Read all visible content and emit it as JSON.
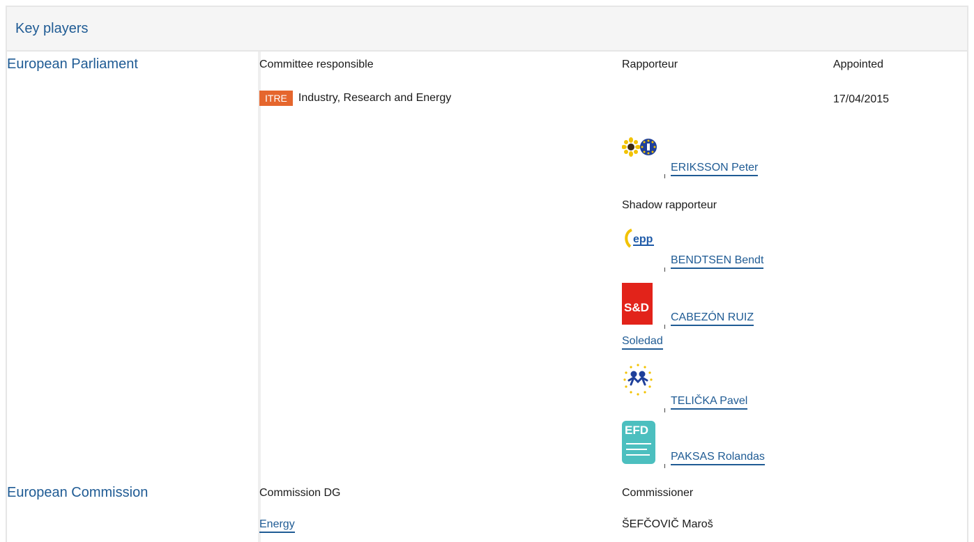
{
  "header": {
    "title": "Key players"
  },
  "parliament": {
    "name": "European Parliament",
    "col_committee": "Committee responsible",
    "col_rapporteur": "Rapporteur",
    "col_appointed": "Appointed",
    "committee_badge": "ITRE",
    "committee_name": "Industry, Research and Energy",
    "appointed_date": "17/04/2015",
    "rapporteur": {
      "name": "ERIKSSON Peter",
      "logo_icon": "greens-efa-logo-icon"
    },
    "shadow_label": "Shadow rapporteur",
    "shadows": [
      {
        "name": "BENDTSEN Bendt",
        "logo_icon": "epp-logo-icon"
      },
      {
        "name": "CABEZÓN RUIZ",
        "name_line2": "Soledad",
        "logo_icon": "sd-logo-icon"
      },
      {
        "name": "TELIČKA Pavel",
        "logo_icon": "alde-logo-icon"
      },
      {
        "name": "PAKSAS Rolandas",
        "logo_icon": "efdd-logo-icon"
      }
    ],
    "logos": {
      "epp_text": "epp",
      "sd_text": "S&D",
      "efdd_text": "EFD"
    }
  },
  "commission": {
    "name": "European Commission",
    "col_dg": "Commission DG",
    "col_commissioner": "Commissioner",
    "dg_value": "Energy",
    "commissioner_value": "ŠEFČOVIČ Maroš"
  },
  "colors": {
    "link": "#1f5b94",
    "badge": "#e5662d",
    "header_bg": "#f5f5f5",
    "sd_red": "#e2231a",
    "efdd_teal": "#4cbfbf"
  }
}
